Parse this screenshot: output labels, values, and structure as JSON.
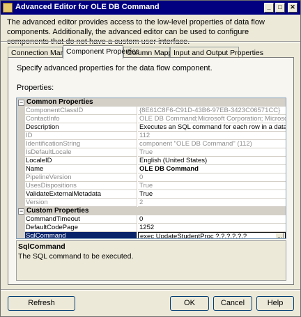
{
  "window": {
    "title": "Advanced Editor for OLE DB Command",
    "minimize_glyph": "_",
    "maximize_glyph": "□",
    "close_glyph": "✕"
  },
  "header": {
    "description": "The advanced editor provides access to the low-level properties of data flow components. Additionally, the advanced editor can be used to configure components that do not have a custom user interface."
  },
  "tabs": [
    {
      "label": "Connection Managers",
      "active": false
    },
    {
      "label": "Component Properties",
      "active": true
    },
    {
      "label": "Column Mappings",
      "active": false
    },
    {
      "label": "Input and Output Properties",
      "active": false
    }
  ],
  "panel": {
    "description": "Specify advanced properties for the data flow component.",
    "properties_label": "Properties:"
  },
  "grid": {
    "common_category": "Common Properties",
    "custom_category": "Custom Properties",
    "expander_glyph": "−",
    "common_rows": [
      {
        "name": "ComponentClassID",
        "value": "{8E61C8F6-C91D-43B6-97EB-3423C06571CC}",
        "dim": true
      },
      {
        "name": "ContactInfo",
        "value": "OLE DB Command;Microsoft Corporation; Microsoft SqlServe",
        "dim": true
      },
      {
        "name": "Description",
        "value": "Executes an SQL command for each row in a dataset.",
        "dim": false
      },
      {
        "name": "ID",
        "value": "112",
        "dim": true
      },
      {
        "name": "IdentificationString",
        "value": "component \"OLE DB Command\" (112)",
        "dim": true
      },
      {
        "name": "IsDefaultLocale",
        "value": "True",
        "dim": true
      },
      {
        "name": "LocaleID",
        "value": "English (United States)",
        "dim": false
      },
      {
        "name": "Name",
        "value": "OLE DB Command",
        "dim": false,
        "bold": true
      },
      {
        "name": "PipelineVersion",
        "value": "0",
        "dim": true
      },
      {
        "name": "UsesDispositions",
        "value": "True",
        "dim": true
      },
      {
        "name": "ValidateExternalMetadata",
        "value": "True",
        "dim": false
      },
      {
        "name": "Version",
        "value": "2",
        "dim": true
      }
    ],
    "custom_rows": [
      {
        "name": "CommandTimeout",
        "value": "0",
        "dim": false
      },
      {
        "name": "DefaultCodePage",
        "value": "1252",
        "dim": false
      },
      {
        "name": "SqlCommand",
        "value": "exec UpdateStudentProc ?,?,?,?,?,?",
        "dim": false,
        "selected": true
      }
    ],
    "ellipsis_label": "..."
  },
  "description_pane": {
    "title": "SqlCommand",
    "text": "The SQL command to be executed."
  },
  "buttons": {
    "refresh": "Refresh",
    "ok": "OK",
    "cancel": "Cancel",
    "help": "Help"
  }
}
